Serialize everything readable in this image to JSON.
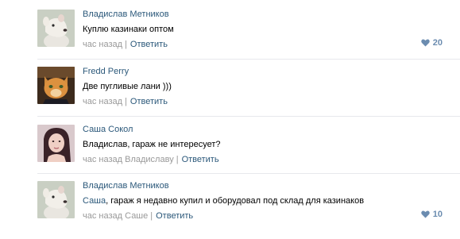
{
  "accent_color": "#2b587a",
  "comments": [
    {
      "avatar_icon": "bull-terrier-avatar-icon",
      "author": "Владислав Метников",
      "text": "Куплю казинаки оптом",
      "mention": "",
      "time": "час назад",
      "reply_to": "",
      "reply_label": "Ответить",
      "likes": "20"
    },
    {
      "avatar_icon": "cat-avatar-icon",
      "author": "Fredd Perry",
      "text": "Две пугливые лани )))",
      "mention": "",
      "time": "час назад",
      "reply_to": "",
      "reply_label": "Ответить",
      "likes": ""
    },
    {
      "avatar_icon": "girl-avatar-icon",
      "author": "Саша Сокол",
      "text": "Владислав, гараж не интересует?",
      "mention": "",
      "time": "час назад",
      "reply_to": "Владиславу",
      "reply_label": "Ответить",
      "likes": ""
    },
    {
      "avatar_icon": "bull-terrier-avatar-icon",
      "author": "Владислав Метников",
      "text": ", гараж я недавно купил и оборудовал под склад для казинаков",
      "mention": "Саша",
      "time": "час назад",
      "reply_to": "Саше",
      "reply_label": "Ответить",
      "likes": "10"
    }
  ]
}
